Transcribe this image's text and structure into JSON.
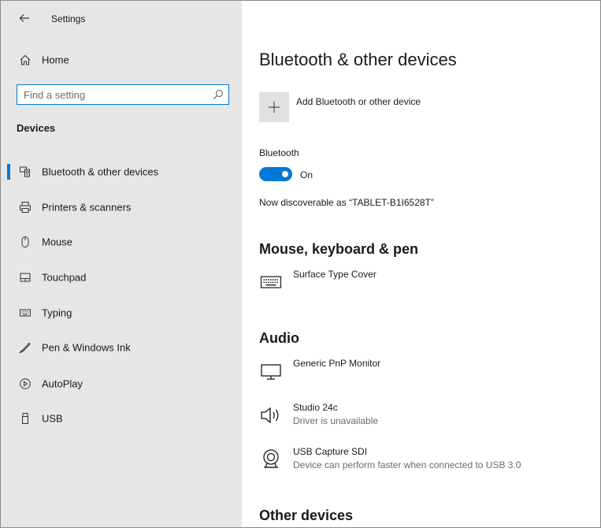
{
  "window": {
    "title": "Settings"
  },
  "sidebar": {
    "home_label": "Home",
    "search_placeholder": "Find a setting",
    "section_heading": "Devices",
    "items": [
      {
        "label": "Bluetooth & other devices",
        "icon": "bluetooth-devices-icon",
        "selected": true
      },
      {
        "label": "Printers & scanners",
        "icon": "printer-icon"
      },
      {
        "label": "Mouse",
        "icon": "mouse-icon"
      },
      {
        "label": "Touchpad",
        "icon": "touchpad-icon"
      },
      {
        "label": "Typing",
        "icon": "keyboard-icon"
      },
      {
        "label": "Pen & Windows Ink",
        "icon": "pen-icon"
      },
      {
        "label": "AutoPlay",
        "icon": "autoplay-icon"
      },
      {
        "label": "USB",
        "icon": "usb-icon"
      }
    ]
  },
  "main": {
    "title": "Bluetooth & other devices",
    "add_device_label": "Add Bluetooth or other device",
    "bluetooth_label": "Bluetooth",
    "bluetooth_state": "On",
    "bluetooth_on": true,
    "discoverable_text": "Now discoverable as “TABLET-B1I6528T”",
    "sections": {
      "mouse_keyboard": {
        "heading": "Mouse, keyboard & pen",
        "devices": [
          {
            "name": "Surface Type Cover",
            "status": "",
            "icon": "keyboard-icon"
          }
        ]
      },
      "audio": {
        "heading": "Audio",
        "devices": [
          {
            "name": "Generic PnP Monitor",
            "status": "",
            "icon": "monitor-icon"
          },
          {
            "name": "Studio 24c",
            "status": "Driver is unavailable",
            "icon": "speaker-icon"
          },
          {
            "name": "USB Capture SDI",
            "status": "Device can perform faster when connected to USB 3.0",
            "icon": "webcam-icon"
          }
        ]
      },
      "other": {
        "heading": "Other devices"
      }
    }
  },
  "colors": {
    "accent": "#0078d7",
    "sidebar_bg": "#e6e6e6",
    "secondary_text": "#6b6b6b"
  }
}
